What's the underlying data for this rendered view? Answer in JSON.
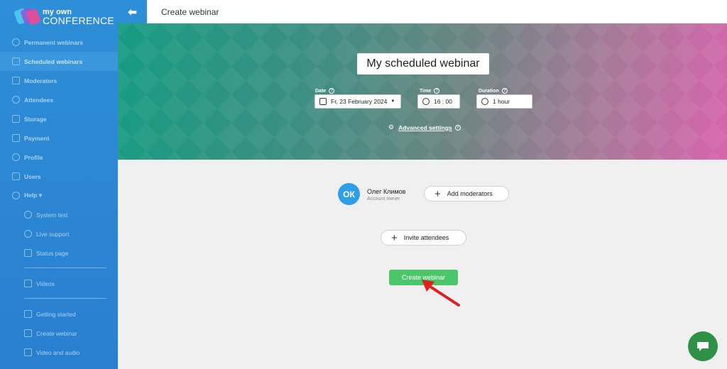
{
  "brand": {
    "line1": "my own",
    "line2": "CONFERENCE"
  },
  "sidebar": {
    "items": [
      {
        "label": "Permanent webinars"
      },
      {
        "label": "Scheduled webinars"
      },
      {
        "label": "Moderators"
      },
      {
        "label": "Attendees"
      },
      {
        "label": "Storage"
      },
      {
        "label": "Payment"
      },
      {
        "label": "Profile"
      },
      {
        "label": "Users"
      },
      {
        "label": "Help ▾"
      }
    ],
    "help_items": [
      {
        "label": "System test"
      },
      {
        "label": "Live support"
      },
      {
        "label": "Status page"
      }
    ],
    "videos": {
      "label": "Videos"
    },
    "guides": [
      {
        "label": "Getting started"
      },
      {
        "label": "Create webinar"
      },
      {
        "label": "Video and audio"
      }
    ]
  },
  "topbar": {
    "back_icon": "arrow-left-icon",
    "title": "Create webinar"
  },
  "hero": {
    "webinar_title": "My scheduled webinar",
    "date_label": "Date",
    "date_value": "Fr, 23 February 2024",
    "time_label": "Time",
    "time_value": "16 : 00",
    "duration_label": "Duration",
    "duration_value": "1 hour",
    "help_glyph": "?",
    "advanced_settings": "Advanced settings"
  },
  "main": {
    "avatar_initials": "ОК",
    "owner_name": "Олег Климов",
    "owner_role": "Account owner",
    "add_moderators": "Add moderators",
    "invite_attendees": "Invite attendees",
    "create_button": "Create webinar"
  },
  "colors": {
    "sidebar": "#2e8ed8",
    "create_button": "#4cc66a",
    "chat_button": "#2e9145",
    "arrow": "#e02020"
  }
}
